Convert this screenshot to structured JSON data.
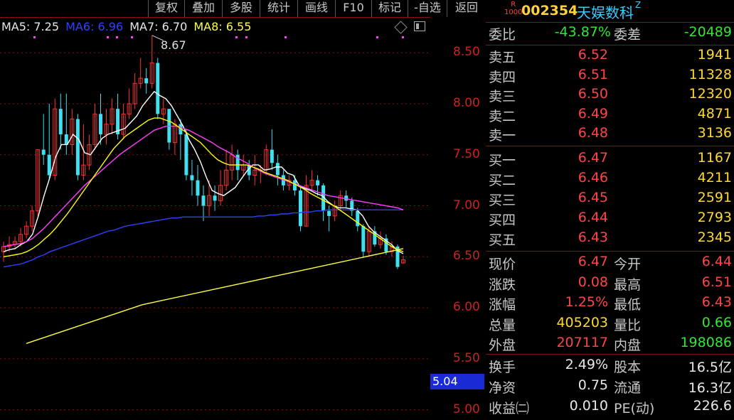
{
  "toolbar": {
    "items": [
      "复权",
      "叠加",
      "多股",
      "统计",
      "画线",
      "F10",
      "标记",
      "-自选",
      "返回"
    ]
  },
  "ma_legend": {
    "ma5": "MA5: 7.25",
    "ma6": "MA6: 6.96",
    "ma7": "MA7: 6.70",
    "ma8": "MA8: 6.55"
  },
  "chart_data": {
    "type": "candlestick",
    "y_ticks": [
      "8.50",
      "8.00",
      "7.50",
      "7.00",
      "6.50",
      "6.00",
      "5.50",
      "5.00"
    ],
    "ylim": [
      4.9,
      8.85
    ],
    "peak_annotation": "8.67",
    "cursor_price": "5.04",
    "candles": [
      {
        "o": 6.55,
        "c": 6.6,
        "h": 6.65,
        "l": 6.45
      },
      {
        "o": 6.6,
        "c": 6.62,
        "h": 6.7,
        "l": 6.55
      },
      {
        "o": 6.62,
        "c": 6.65,
        "h": 6.7,
        "l": 6.58
      },
      {
        "o": 6.65,
        "c": 6.72,
        "h": 6.78,
        "l": 6.6
      },
      {
        "o": 6.72,
        "c": 6.8,
        "h": 6.85,
        "l": 6.68
      },
      {
        "o": 6.8,
        "c": 6.95,
        "h": 7.0,
        "l": 6.75
      },
      {
        "o": 6.95,
        "c": 7.55,
        "h": 7.55,
        "l": 6.9
      },
      {
        "o": 7.55,
        "c": 7.5,
        "h": 7.9,
        "l": 7.4
      },
      {
        "o": 7.5,
        "c": 7.3,
        "h": 8.0,
        "l": 7.25
      },
      {
        "o": 7.3,
        "c": 7.95,
        "h": 8.05,
        "l": 7.25
      },
      {
        "o": 7.95,
        "c": 7.7,
        "h": 8.1,
        "l": 7.55
      },
      {
        "o": 7.7,
        "c": 7.6,
        "h": 8.1,
        "l": 7.5
      },
      {
        "o": 7.6,
        "c": 7.85,
        "h": 7.95,
        "l": 7.5
      },
      {
        "o": 7.85,
        "c": 7.3,
        "h": 7.9,
        "l": 7.25
      },
      {
        "o": 7.3,
        "c": 7.4,
        "h": 7.8,
        "l": 7.25
      },
      {
        "o": 7.4,
        "c": 7.6,
        "h": 7.7,
        "l": 7.35
      },
      {
        "o": 7.6,
        "c": 7.9,
        "h": 8.0,
        "l": 7.55
      },
      {
        "o": 7.9,
        "c": 7.7,
        "h": 8.1,
        "l": 7.6
      },
      {
        "o": 7.7,
        "c": 7.8,
        "h": 7.95,
        "l": 7.6
      },
      {
        "o": 7.8,
        "c": 7.95,
        "h": 8.05,
        "l": 7.7
      },
      {
        "o": 7.95,
        "c": 7.7,
        "h": 8.1,
        "l": 7.65
      },
      {
        "o": 7.7,
        "c": 7.9,
        "h": 8.0,
        "l": 7.65
      },
      {
        "o": 7.9,
        "c": 8.0,
        "h": 8.15,
        "l": 7.85
      },
      {
        "o": 8.0,
        "c": 8.2,
        "h": 8.3,
        "l": 7.95
      },
      {
        "o": 8.2,
        "c": 8.25,
        "h": 8.45,
        "l": 8.15
      },
      {
        "o": 8.25,
        "c": 8.2,
        "h": 8.35,
        "l": 8.1
      },
      {
        "o": 8.2,
        "c": 8.4,
        "h": 8.67,
        "l": 8.15
      },
      {
        "o": 8.4,
        "c": 7.9,
        "h": 8.45,
        "l": 7.85
      },
      {
        "o": 7.9,
        "c": 7.95,
        "h": 8.05,
        "l": 7.8
      },
      {
        "o": 7.95,
        "c": 7.62,
        "h": 7.9,
        "l": 7.55
      },
      {
        "o": 7.62,
        "c": 7.8,
        "h": 7.85,
        "l": 7.5
      },
      {
        "o": 7.8,
        "c": 7.7,
        "h": 7.85,
        "l": 7.45
      },
      {
        "o": 7.7,
        "c": 7.3,
        "h": 7.75,
        "l": 7.25
      },
      {
        "o": 7.3,
        "c": 7.25,
        "h": 7.45,
        "l": 7.1
      },
      {
        "o": 7.25,
        "c": 7.1,
        "h": 7.4,
        "l": 7.0
      },
      {
        "o": 7.1,
        "c": 7.0,
        "h": 7.2,
        "l": 6.85
      },
      {
        "o": 7.0,
        "c": 7.1,
        "h": 7.25,
        "l": 6.9
      },
      {
        "o": 7.1,
        "c": 7.05,
        "h": 7.2,
        "l": 6.95
      },
      {
        "o": 7.05,
        "c": 7.2,
        "h": 7.35,
        "l": 7.0
      },
      {
        "o": 7.2,
        "c": 7.35,
        "h": 7.55,
        "l": 7.15
      },
      {
        "o": 7.35,
        "c": 7.5,
        "h": 7.6,
        "l": 7.25
      },
      {
        "o": 7.5,
        "c": 7.35,
        "h": 7.55,
        "l": 7.25
      },
      {
        "o": 7.35,
        "c": 7.4,
        "h": 7.5,
        "l": 7.3
      },
      {
        "o": 7.4,
        "c": 7.3,
        "h": 7.45,
        "l": 7.25
      },
      {
        "o": 7.3,
        "c": 7.35,
        "h": 7.5,
        "l": 7.2
      },
      {
        "o": 7.35,
        "c": 7.35,
        "h": 7.4,
        "l": 7.22
      },
      {
        "o": 7.35,
        "c": 7.55,
        "h": 7.6,
        "l": 7.3
      },
      {
        "o": 7.55,
        "c": 7.42,
        "h": 7.75,
        "l": 7.35
      },
      {
        "o": 7.42,
        "c": 7.3,
        "h": 7.5,
        "l": 7.2
      },
      {
        "o": 7.3,
        "c": 7.2,
        "h": 7.35,
        "l": 7.15
      },
      {
        "o": 7.2,
        "c": 7.25,
        "h": 7.3,
        "l": 7.15
      },
      {
        "o": 7.25,
        "c": 7.15,
        "h": 7.3,
        "l": 7.1
      },
      {
        "o": 7.15,
        "c": 6.8,
        "h": 7.2,
        "l": 6.75
      },
      {
        "o": 6.8,
        "c": 7.2,
        "h": 7.3,
        "l": 6.8
      },
      {
        "o": 7.2,
        "c": 7.25,
        "h": 7.35,
        "l": 7.15
      },
      {
        "o": 7.25,
        "c": 7.2,
        "h": 7.3,
        "l": 7.1
      },
      {
        "o": 7.2,
        "c": 6.95,
        "h": 7.22,
        "l": 6.85
      },
      {
        "o": 6.95,
        "c": 6.9,
        "h": 7.0,
        "l": 6.75
      },
      {
        "o": 6.9,
        "c": 7.0,
        "h": 7.05,
        "l": 6.85
      },
      {
        "o": 7.0,
        "c": 7.1,
        "h": 7.15,
        "l": 6.95
      },
      {
        "o": 7.1,
        "c": 7.05,
        "h": 7.15,
        "l": 6.98
      },
      {
        "o": 7.05,
        "c": 6.95,
        "h": 7.08,
        "l": 6.9
      },
      {
        "o": 6.95,
        "c": 6.8,
        "h": 6.98,
        "l": 6.75
      },
      {
        "o": 6.8,
        "c": 6.55,
        "h": 6.82,
        "l": 6.5
      },
      {
        "o": 6.55,
        "c": 6.75,
        "h": 6.8,
        "l": 6.5
      },
      {
        "o": 6.75,
        "c": 6.62,
        "h": 6.8,
        "l": 6.6
      },
      {
        "o": 6.62,
        "c": 6.68,
        "h": 6.75,
        "l": 6.58
      },
      {
        "o": 6.68,
        "c": 6.55,
        "h": 6.72,
        "l": 6.52
      },
      {
        "o": 6.55,
        "c": 6.6,
        "h": 6.65,
        "l": 6.5
      },
      {
        "o": 6.6,
        "c": 6.4,
        "h": 6.62,
        "l": 6.38
      },
      {
        "o": 6.44,
        "c": 6.47,
        "h": 6.51,
        "l": 6.43
      }
    ],
    "ma_lines": [
      {
        "name": "MA5",
        "color": "#ffffff",
        "values": [
          6.55,
          6.57,
          6.58,
          6.62,
          6.65,
          6.72,
          6.9,
          7.1,
          7.28,
          7.48,
          7.6,
          7.6,
          7.7,
          7.65,
          7.52,
          7.5,
          7.58,
          7.66,
          7.7,
          7.72,
          7.74,
          7.76,
          7.82,
          7.88,
          7.98,
          8.05,
          8.12,
          8.08,
          8.05,
          7.98,
          7.88,
          7.78,
          7.65,
          7.55,
          7.43,
          7.28,
          7.15,
          7.12,
          7.1,
          7.14,
          7.18,
          7.26,
          7.34,
          7.4,
          7.4,
          7.35,
          7.36,
          7.38,
          7.38,
          7.32,
          7.3,
          7.2,
          7.17,
          7.15,
          7.12,
          7.1,
          7.04,
          7.0,
          6.98,
          6.98,
          6.97,
          6.96,
          6.9,
          6.8,
          6.74,
          6.7,
          6.66,
          6.62,
          6.56,
          6.53
        ]
      },
      {
        "name": "MA6",
        "color": "#3040ff",
        "values": [
          6.4,
          6.41,
          6.42,
          6.43,
          6.45,
          6.47,
          6.5,
          6.52,
          6.55,
          6.57,
          6.59,
          6.61,
          6.63,
          6.65,
          6.67,
          6.69,
          6.71,
          6.73,
          6.75,
          6.76,
          6.78,
          6.8,
          6.81,
          6.82,
          6.83,
          6.84,
          6.85,
          6.86,
          6.87,
          6.88,
          6.88,
          6.89,
          6.89,
          6.89,
          6.89,
          6.89,
          6.89,
          6.89,
          6.89,
          6.89,
          6.89,
          6.89,
          6.89,
          6.89,
          6.9,
          6.9,
          6.91,
          6.91,
          6.92,
          6.92,
          6.93,
          6.93,
          6.94,
          6.94,
          6.95,
          6.95,
          6.96,
          6.96,
          6.96,
          6.96,
          6.96,
          6.96,
          6.96,
          6.96,
          6.96,
          6.96,
          6.96,
          6.96,
          6.96,
          6.96
        ]
      },
      {
        "name": "MA7",
        "color": "#ff40ff",
        "values": [
          6.6,
          6.61,
          6.62,
          6.63,
          6.65,
          6.68,
          6.73,
          6.78,
          6.84,
          6.9,
          6.96,
          7.02,
          7.08,
          7.14,
          7.2,
          7.25,
          7.3,
          7.35,
          7.4,
          7.45,
          7.5,
          7.54,
          7.58,
          7.62,
          7.66,
          7.7,
          7.74,
          7.76,
          7.78,
          7.78,
          7.78,
          7.76,
          7.74,
          7.71,
          7.68,
          7.65,
          7.62,
          7.58,
          7.55,
          7.52,
          7.48,
          7.45,
          7.42,
          7.38,
          7.35,
          7.32,
          7.3,
          7.28,
          7.26,
          7.24,
          7.22,
          7.2,
          7.18,
          7.16,
          7.14,
          7.12,
          7.1,
          7.09,
          7.08,
          7.07,
          7.06,
          7.05,
          7.04,
          7.03,
          7.02,
          7.01,
          7.0,
          6.99,
          6.98,
          6.96
        ]
      },
      {
        "name": "MA8",
        "color": "#ffff00",
        "values": [
          6.5,
          6.51,
          6.52,
          6.53,
          6.55,
          6.58,
          6.62,
          6.67,
          6.72,
          6.78,
          6.85,
          6.92,
          7.0,
          7.08,
          7.16,
          7.24,
          7.32,
          7.4,
          7.48,
          7.56,
          7.62,
          7.68,
          7.72,
          7.76,
          7.8,
          7.84,
          7.86,
          7.86,
          7.84,
          7.82,
          7.78,
          7.74,
          7.7,
          7.66,
          7.62,
          7.56,
          7.5,
          7.45,
          7.42,
          7.4,
          7.4,
          7.4,
          7.4,
          7.38,
          7.36,
          7.33,
          7.31,
          7.29,
          7.27,
          7.25,
          7.22,
          7.19,
          7.16,
          7.12,
          7.09,
          7.06,
          7.03,
          7.0,
          6.96,
          6.92,
          6.88,
          6.84,
          6.8,
          6.76,
          6.72,
          6.68,
          6.64,
          6.6,
          6.57,
          6.55
        ]
      }
    ]
  },
  "quote": {
    "r_badge_top": "R",
    "r_badge_bottom": "1000",
    "code": "002354",
    "name": "天娱数科",
    "flag": "Z",
    "webi_label": "委比",
    "webi_value": "-43.87%",
    "weicha_label": "委差",
    "weicha_value": "-20489",
    "asks": [
      {
        "label": "卖五",
        "price": "6.52",
        "vol": "1941"
      },
      {
        "label": "卖四",
        "price": "6.51",
        "vol": "11328"
      },
      {
        "label": "卖三",
        "price": "6.50",
        "vol": "12320"
      },
      {
        "label": "卖二",
        "price": "6.49",
        "vol": "4871"
      },
      {
        "label": "卖一",
        "price": "6.48",
        "vol": "3136"
      }
    ],
    "bids": [
      {
        "label": "买一",
        "price": "6.47",
        "vol": "1167"
      },
      {
        "label": "买二",
        "price": "6.46",
        "vol": "4211"
      },
      {
        "label": "买三",
        "price": "6.45",
        "vol": "2591"
      },
      {
        "label": "买四",
        "price": "6.44",
        "vol": "2793"
      },
      {
        "label": "买五",
        "price": "6.43",
        "vol": "2345"
      }
    ],
    "stats": [
      {
        "l1": "现价",
        "v1": "6.47",
        "c1": "red",
        "l2": "今开",
        "v2": "6.44",
        "c2": "red"
      },
      {
        "l1": "涨跌",
        "v1": "0.08",
        "c1": "red",
        "l2": "最高",
        "v2": "6.51",
        "c2": "red"
      },
      {
        "l1": "涨幅",
        "v1": "1.25%",
        "c1": "red",
        "l2": "最低",
        "v2": "6.43",
        "c2": "red"
      },
      {
        "l1": "总量",
        "v1": "405203",
        "c1": "yellow",
        "l2": "量比",
        "v2": "0.66",
        "c2": "green"
      },
      {
        "l1": "外盘",
        "v1": "207117",
        "c1": "red",
        "l2": "内盘",
        "v2": "198086",
        "c2": "green"
      }
    ],
    "fund": [
      {
        "l1": "换手",
        "v1": "2.49%",
        "l2": "股本",
        "v2": "16.5亿"
      },
      {
        "l1": "净资",
        "v1": "0.75",
        "l2": "流通",
        "v2": "16.3亿"
      },
      {
        "l1": "收益㈡",
        "v1": "0.010",
        "l2": "PE(动)",
        "v2": "226.6"
      }
    ]
  },
  "colors": {
    "up": "#ff3030",
    "down": "#40e0f0",
    "grid": "#8a1010"
  }
}
